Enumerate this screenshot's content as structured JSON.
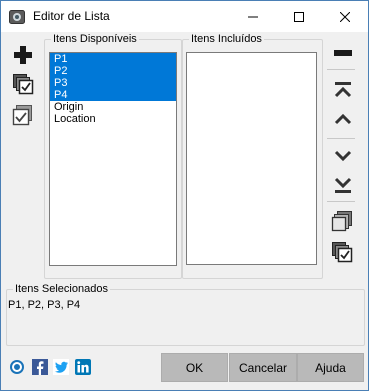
{
  "window": {
    "title": "Editor de Lista"
  },
  "available": {
    "label": "Itens Disponíveis",
    "items": [
      "P1",
      "P2",
      "P3",
      "P4",
      "Origin",
      "Location"
    ],
    "selected": [
      0,
      1,
      2,
      3
    ]
  },
  "included": {
    "label": "Itens Incluídos",
    "items": []
  },
  "selection": {
    "label": "Itens Selecionados",
    "value": "P1, P2, P3, P4"
  },
  "buttons": {
    "ok": "OK",
    "cancel": "Cancelar",
    "help": "Ajuda"
  },
  "colors": {
    "selection": "#0078d7",
    "button": "#b9b9b9",
    "facebook": "#3b5998",
    "twitter": "#1da1f2",
    "linkedin": "#0077b5"
  }
}
